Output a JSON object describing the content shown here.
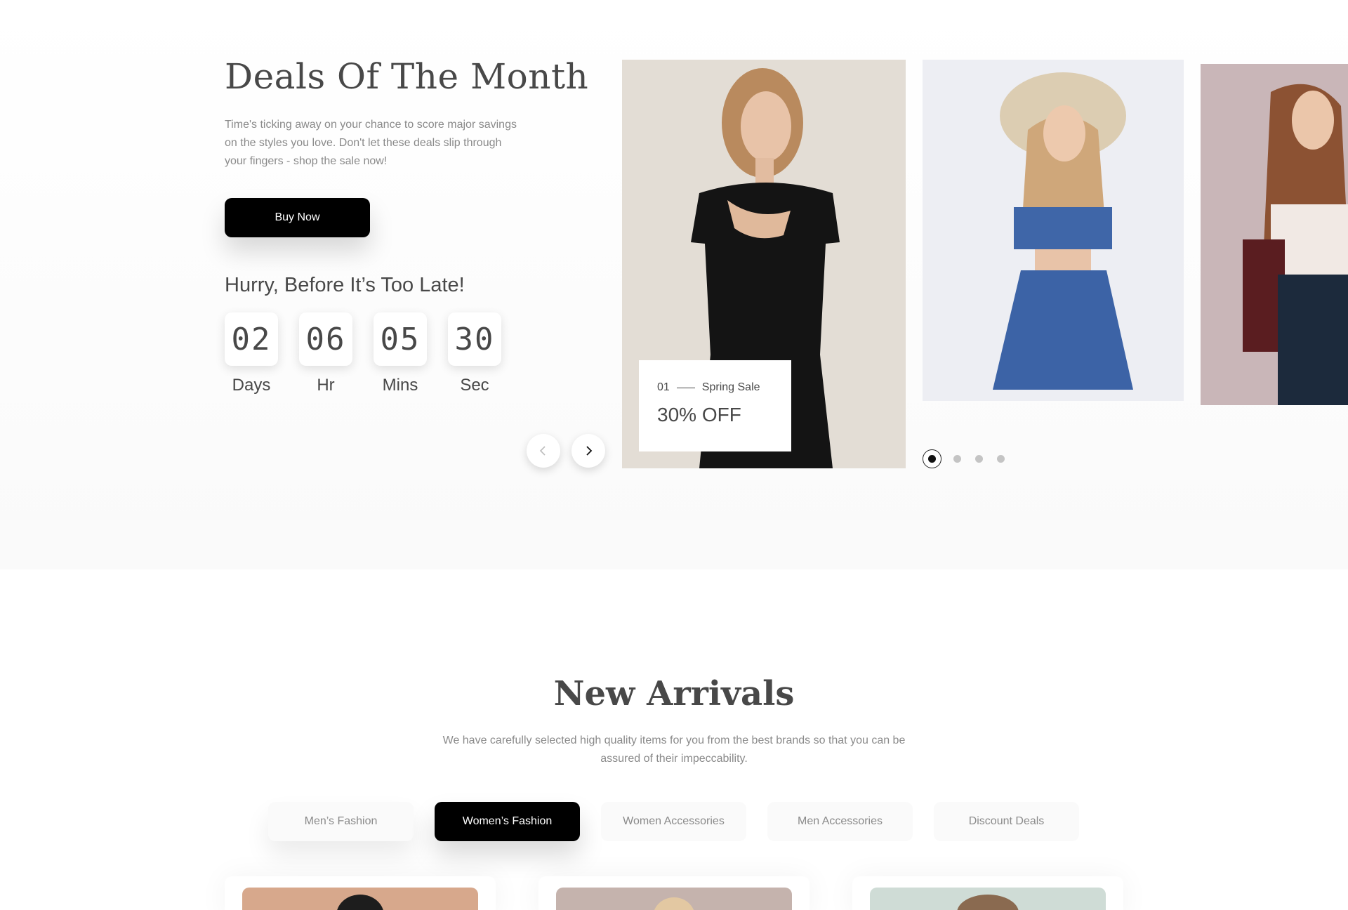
{
  "deals": {
    "title": "Deals Of The Month",
    "description": "Time's ticking away on your chance to score major savings on the styles you love. Don't let these deals slip through your fingers - shop the sale now!",
    "buy_label": "Buy Now",
    "hurry_text": "Hurry, Before It’s Too Late!",
    "countdown": [
      {
        "value": "02",
        "label": "Days"
      },
      {
        "value": "06",
        "label": "Hr"
      },
      {
        "value": "05",
        "label": "Mins"
      },
      {
        "value": "30",
        "label": "Sec"
      }
    ],
    "slide_card": {
      "index": "01",
      "name": "Spring Sale",
      "discount": "30% OFF"
    },
    "active_dot": 1,
    "dot_count": 4
  },
  "new_arrivals": {
    "title": "New Arrivals",
    "description": "We have carefully selected high quality items for you from the best brands so that you can be assured of their impeccability.",
    "tabs": [
      {
        "label": "Men’s Fashion",
        "active": false
      },
      {
        "label": "Women’s Fashion",
        "active": true
      },
      {
        "label": "Women Accessories",
        "active": false
      },
      {
        "label": "Men Accessories",
        "active": false
      },
      {
        "label": "Discount Deals",
        "active": false
      }
    ]
  },
  "colors": {
    "primary": "#000000",
    "text": "#484848",
    "muted": "#8a8a8a",
    "tab_bg": "#fafafa"
  },
  "icons": [
    "chevron-left-icon",
    "chevron-right-icon"
  ]
}
